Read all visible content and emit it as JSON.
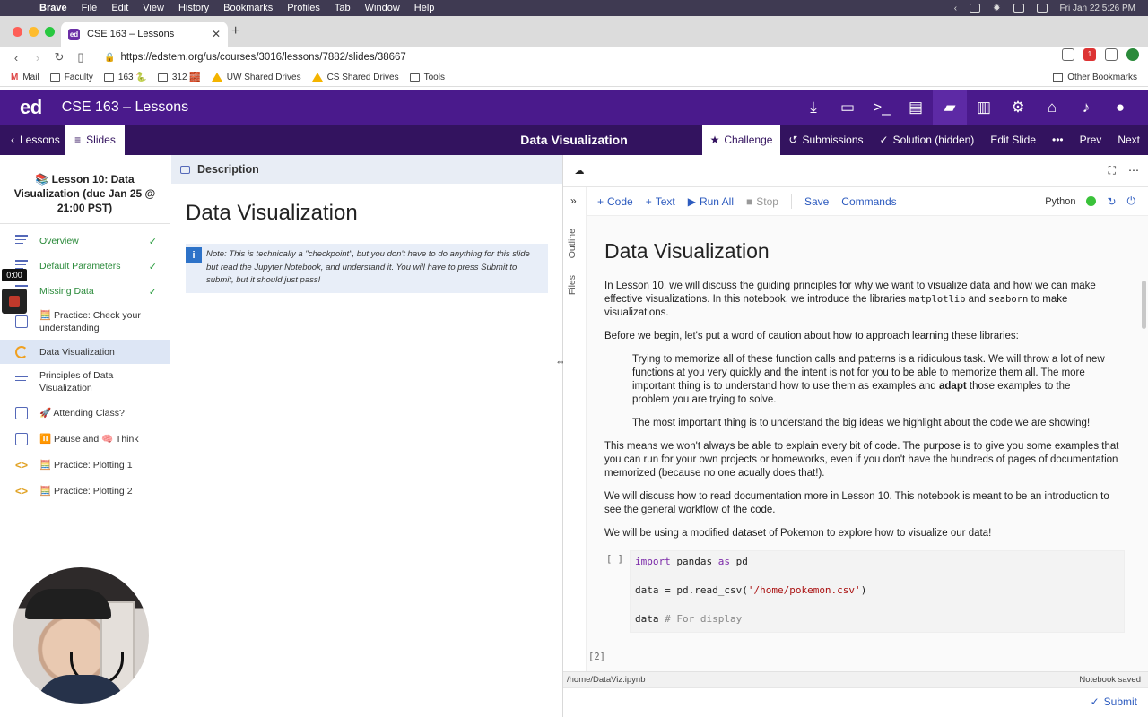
{
  "macos": {
    "app": "Brave",
    "menus": [
      "File",
      "Edit",
      "View",
      "History",
      "Bookmarks",
      "Profiles",
      "Tab",
      "Window",
      "Help"
    ],
    "clock": "Fri Jan 22  5:26 PM"
  },
  "browser": {
    "tab_title": "CSE 163 – Lessons",
    "tab_favicon": "ed",
    "url": "https://edstem.org/us/courses/3016/lessons/7882/slides/38667",
    "badge_count": "1",
    "bookmarks": [
      "Mail",
      "Faculty",
      "163 🐍",
      "312 🧱",
      "UW Shared Drives",
      "CS Shared Drives",
      "Tools"
    ],
    "other_bookmarks": "Other Bookmarks"
  },
  "ed": {
    "logo": "ed",
    "course_title": "CSE 163 – Lessons"
  },
  "subheader": {
    "lessons_label": "Lessons",
    "slides_label": "Slides",
    "center_title": "Data Visualization",
    "challenge_label": "Challenge",
    "submissions_label": "Submissions",
    "solution_label": "Solution (hidden)",
    "edit_slide_label": "Edit Slide",
    "more_label": "•••",
    "prev_label": "Prev",
    "next_label": "Next"
  },
  "sidebar": {
    "lesson_title": "📚 Lesson 10: Data Visualization (due Jan 25 @ 21:00 PST)",
    "items": [
      {
        "label": "Overview",
        "icon": "document-icon",
        "done": "✓"
      },
      {
        "label": "Default Parameters",
        "icon": "document-icon",
        "done": "✓"
      },
      {
        "label": "Missing Data",
        "icon": "document-icon",
        "done": "✓"
      },
      {
        "label": "🧮 Practice: Check your understanding",
        "icon": "quiz-icon",
        "done": ""
      },
      {
        "label": "Data Visualization",
        "icon": "notebook-icon",
        "done": ""
      },
      {
        "label": "Principles of Data Visualization",
        "icon": "document-icon",
        "done": ""
      },
      {
        "label": "🚀 Attending Class?",
        "icon": "quiz-icon",
        "done": ""
      },
      {
        "label": "⏸️ Pause and 🧠 Think",
        "icon": "quiz-icon",
        "done": ""
      },
      {
        "label": "🧮 Practice: Plotting 1",
        "icon": "code-icon",
        "done": ""
      },
      {
        "label": "🧮 Practice: Plotting 2",
        "icon": "code-icon",
        "done": ""
      }
    ],
    "timer": "0:00"
  },
  "description": {
    "header": "Description",
    "title": "Data Visualization",
    "note_icon": "i",
    "note": "Note: This is technically a \"checkpoint\", but you don't have to do anything for this slide but read the Jupyter Notebook, and understand it. You will have to press Submit to submit, but it should just pass!"
  },
  "notebook": {
    "toolbar": {
      "code": "Code",
      "text": "Text",
      "run_all": "Run All",
      "stop": "Stop",
      "save": "Save",
      "commands": "Commands",
      "kernel": "Python"
    },
    "side_tabs": {
      "outline": "Outline",
      "files": "Files"
    },
    "title": "Data Visualization",
    "p1_a": "In Lesson 10, we will discuss the guiding principles for why we want to visualize data and how we can make effective visualizations. In this notebook, we introduce the libraries ",
    "p1_code1": "matplotlib",
    "p1_mid": " and ",
    "p1_code2": "seaborn",
    "p1_b": " to make visualizations.",
    "p2": "Before we begin, let's put a word of caution about how to approach learning these libraries:",
    "q1_a": "Trying to memorize all of these function calls and patterns is a ridiculous task. We will throw a lot of new functions at you very quickly and the intent is not for you to be able to memorize them all. The more important thing is to understand how to use them as examples and ",
    "q1_bold": "adapt",
    "q1_b": " those examples to the problem you are trying to solve.",
    "q2": "The most important thing is to understand the big ideas we highlight about the code we are showing!",
    "p3": "This means we won't always be able to explain every bit of code. The purpose is to give you some examples that you can run for your own projects or homeworks, even if you don't have the hundreds of pages of documentation memorized (because no one acually does that!).",
    "p4": "We will discuss how to read documentation more in Lesson 10. This notebook is meant to be an introduction to see the general workflow of the code.",
    "p5": "We will be using a modified dataset of Pokemon to explore how to visualize our data!",
    "cell_prompt": "[ ]",
    "code_kw_import": "import",
    "code_mod": "pandas",
    "code_kw_as": "as",
    "code_alias": "pd",
    "code_line2_a": "data = pd.read_csv(",
    "code_line2_str": "'/home/pokemon.csv'",
    "code_line2_b": ")",
    "code_line3_a": "data",
    "code_line3_cm": "# For display",
    "out_prompt": "[2]",
    "status_path": "/home/DataViz.ipynb",
    "status_saved": "Notebook saved",
    "submit": "Submit"
  }
}
